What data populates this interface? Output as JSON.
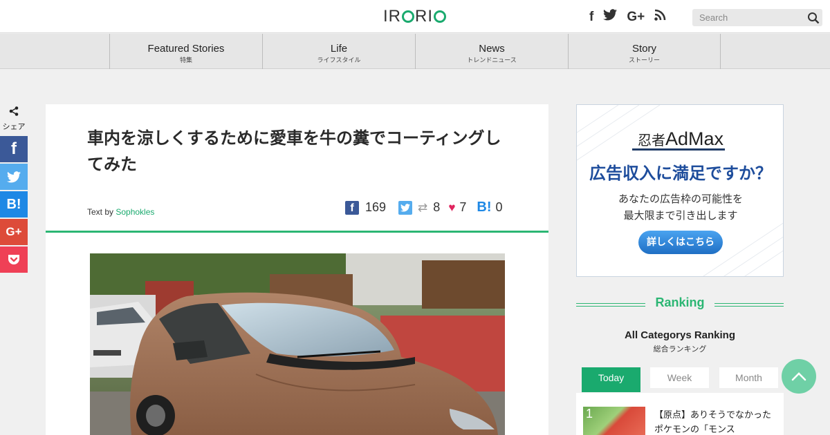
{
  "header": {
    "logo_text": "IRORIO",
    "search_placeholder": "Search",
    "social_icons": [
      "facebook-icon",
      "twitter-icon",
      "google-plus-icon",
      "rss-icon"
    ]
  },
  "nav": {
    "items": [
      {
        "label": "Featured Stories",
        "sub": "特集"
      },
      {
        "label": "Life",
        "sub": "ライフスタイル"
      },
      {
        "label": "News",
        "sub": "トレンドニュース"
      },
      {
        "label": "Story",
        "sub": "ストーリー"
      }
    ]
  },
  "share": {
    "label": "シェア",
    "buttons": [
      {
        "icon": "facebook-icon",
        "glyph": "f",
        "color": "#3b5998"
      },
      {
        "icon": "twitter-icon",
        "glyph": "",
        "color": "#55acee"
      },
      {
        "icon": "hatena-icon",
        "glyph": "B!",
        "color": "#1e88e5"
      },
      {
        "icon": "google-plus-icon",
        "glyph": "G+",
        "color": "#dd4b39"
      },
      {
        "icon": "pocket-icon",
        "glyph": "",
        "color": "#ef4056"
      }
    ]
  },
  "article": {
    "title": "車内を涼しくするために愛車を牛の糞でコーティングしてみた",
    "byline_prefix": "Text by",
    "author": "Sophokles",
    "counts": {
      "facebook": "169",
      "retweets": "8",
      "likes": "7",
      "hatena": "0"
    },
    "accent_color": "#2bb673"
  },
  "ad": {
    "brand": "忍者AdMax",
    "brand_jp": "忍者",
    "brand_en": "AdMax",
    "headline": "広告収入に満足ですか？",
    "body_line1": "あなたの広告枠の可能性を",
    "body_line2": "最大限まで引き出します",
    "button": "詳しくはこちら"
  },
  "ranking": {
    "title": "Ranking",
    "subtitle": "All Categorys Ranking",
    "subtitle_jp": "総合ランキング",
    "tabs": [
      "Today",
      "Week",
      "Month"
    ],
    "active_tab": "Today",
    "items": [
      {
        "rank": "1",
        "text": "【原点】ありそうでなかったポケモンの「モンス"
      }
    ]
  }
}
